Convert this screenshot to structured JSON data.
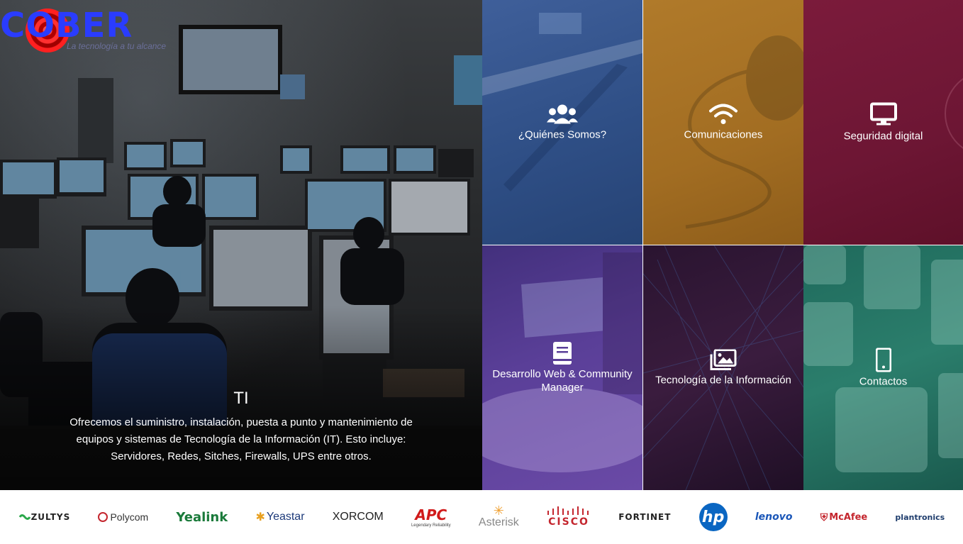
{
  "brand": {
    "logo_text": "COBER",
    "slogan": "La tecnología a tu alcance"
  },
  "hero": {
    "title": "TI",
    "description": "Ofrecemos el suministro, instalación, puesta a punto y mantenimiento de equipos y sistemas de Tecnología de la Información (IT). Esto incluye: Servidores, Redes, Sitches, Firewalls, UPS entre otros."
  },
  "tiles": [
    {
      "label": "¿Quiénes Somos?",
      "icon": "users-icon",
      "color": "#3a5a94"
    },
    {
      "label": "Comunicaciones",
      "icon": "wifi-icon",
      "color": "#a26d22"
    },
    {
      "label": "Seguridad digital",
      "icon": "monitor-icon",
      "color": "#6d1634"
    },
    {
      "label": "Desarrollo Web & Community Manager",
      "icon": "book-icon",
      "color": "#5a3f98"
    },
    {
      "label": "Tecnología de la Información",
      "icon": "images-icon",
      "color": "#3a1c3e"
    },
    {
      "label": "Contactos",
      "icon": "mobile-icon",
      "color": "#2b7e6c"
    }
  ],
  "partners": [
    "ZULTYS",
    "Polycom",
    "Yealink",
    "Yeastar",
    "XORCOM",
    "APC",
    "Asterisk",
    "CISCO",
    "FORTINET",
    "hp",
    "lenovo",
    "McAfee",
    "plantronics"
  ],
  "partners_taglines": {
    "apc": "Legendary Reliability"
  }
}
